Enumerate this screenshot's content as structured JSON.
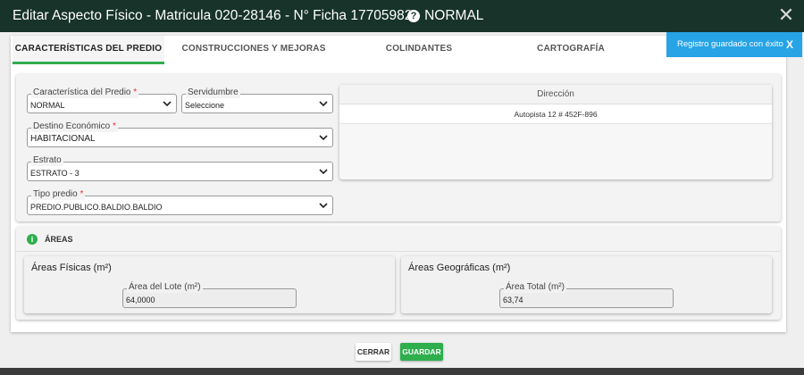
{
  "header": {
    "title": "Editar Aspecto Físico - Matricula 020-28146 - N° Ficha 17705982 - NORMAL",
    "help_glyph": "?",
    "close_glyph": "✕"
  },
  "tabs": [
    {
      "label": "CARACTERÍSTICAS DEL PREDIO",
      "active": true
    },
    {
      "label": "CONSTRUCCIONES Y MEJORAS",
      "active": false
    },
    {
      "label": "COLINDANTES",
      "active": false
    },
    {
      "label": "CARTOGRAFÍA",
      "active": false
    }
  ],
  "toast": {
    "message": "Registro guardado con éxito",
    "close_glyph": "X",
    "color": "#26a4e6"
  },
  "form": {
    "caracteristica": {
      "label": "Característica del Predio",
      "required_mark": "*",
      "value": "NORMAL"
    },
    "servidumbre": {
      "label": "Servidumbre",
      "value": "Seleccione"
    },
    "destino": {
      "label": "Destino Económico",
      "required_mark": "*",
      "value": "HABITACIONAL"
    },
    "estrato": {
      "label": "Estrato",
      "value": "ESTRATO - 3"
    },
    "tipo_predio": {
      "label": "Tipo predio",
      "required_mark": "*",
      "value": "PREDIO.PUBLICO.BALDIO.BALDIO"
    }
  },
  "direccion": {
    "header": "Dirección",
    "rows": [
      "Autopista 12 # 452F-896"
    ]
  },
  "areas": {
    "title": "ÁREAS",
    "info_glyph": "i",
    "fisicas": {
      "title": "Áreas Físicas (m²)",
      "field_label": "Área del Lote (m²)",
      "value": "64,0000"
    },
    "geograficas": {
      "title": "Áreas Geográficas (m²)",
      "field_label": "Área Total (m²)",
      "value": "63,74"
    }
  },
  "footer": {
    "cerrar_label": "CERRAR",
    "guardar_label": "GUARDAR"
  },
  "colors": {
    "header_bg": "#17332a",
    "accent_green": "#2fae4e",
    "required_red": "#e03030"
  }
}
